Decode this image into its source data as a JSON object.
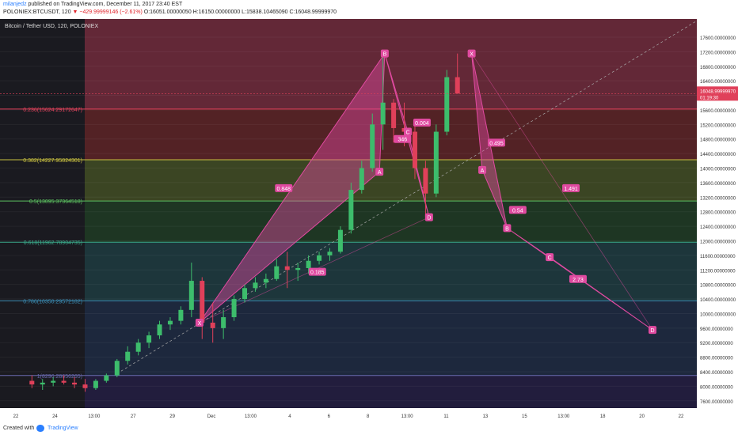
{
  "header": {
    "author": "milanjedz",
    "published": " published on TradingView.com, December 11, 2017 23:40 EST",
    "symbol": "POLONIEX:BTCUSDT, 120",
    "change": "▼ −429.99999146 (−2.61%)",
    "o": " O:16051.00000050",
    "h": " H:16150.00000000",
    "l": " L:15838.10465090",
    "c": " C:16048.99999970"
  },
  "footer": {
    "created_with": "Created with",
    "brand": "TradingView"
  },
  "colors": {
    "background": "#1a1a20",
    "fib_pink": "#6b2a3a",
    "fib_red": "#5a2426",
    "fib_olive": "#3f4a24",
    "fib_green": "#1f3a24",
    "fib_teal": "#1e3a3e",
    "fib_blue": "#1e2a40",
    "fib_purple": "#231e40",
    "up_candle": "#3dbd6c",
    "down_candle": "#e0405a",
    "pattern_fill": "#e04aa0",
    "price_tag": "#e0405a"
  },
  "chart_data": {
    "type": "candlestick",
    "title": "Bitcoin / Tether USD, 120, POLONIEX",
    "ylim": [
      7400,
      18100
    ],
    "x_ticks": [
      "22",
      "24",
      "13:00",
      "27",
      "29",
      "Dec",
      "13:00",
      "4",
      "6",
      "8",
      "13:00",
      "11",
      "13",
      "15",
      "13:00",
      "18",
      "20",
      "22"
    ],
    "y_ticks": [
      "17600.00000000",
      "17200.00000000",
      "16800.00000000",
      "16400.00000000",
      "16000.00000000",
      "15600.00000000",
      "15200.00000000",
      "14800.00000000",
      "14400.00000000",
      "14000.00000000",
      "13600.00000000",
      "13200.00000000",
      "12800.00000000",
      "12400.00000000",
      "12000.00000000",
      "11600.00000000",
      "11200.00000000",
      "10800.00000000",
      "10400.00000000",
      "10000.00000000",
      "9600.00000000",
      "9200.00000000",
      "8800.00000000",
      "8400.00000000",
      "8000.00000000",
      "7600.00000000"
    ],
    "fib_levels": [
      {
        "label": "0.236(15624.29172647)",
        "value": 15624.29,
        "color": "#e0405a"
      },
      {
        "label": "0.382(14227.95824301)",
        "value": 14227.96,
        "color": "#c8c040"
      },
      {
        "label": "0.5(13095.37364518)",
        "value": 13095.37,
        "color": "#5cc060"
      },
      {
        "label": "0.618(11962.78904735)",
        "value": 11962.79,
        "color": "#3aaa8a"
      },
      {
        "label": "0.786(10350.29572182)",
        "value": 10350.3,
        "color": "#3a8ab0"
      },
      {
        "label": "1(8296.28656265)",
        "value": 8296.29,
        "color": "#6a6ab0"
      }
    ],
    "current_price": {
      "value": 16048.9999997,
      "label": "16048.99999970",
      "countdown": "01:19:30"
    },
    "pattern_points": [
      {
        "label": "X",
        "x": "Nov 29 09:00",
        "y": 9750
      },
      {
        "label": "A",
        "x": "Dec 7 20:00",
        "y": 13900
      },
      {
        "label": "B",
        "x": "Dec 8 02:00",
        "y": 17150
      },
      {
        "label": "C",
        "x": "Dec 9 04:00",
        "y": 15000
      },
      {
        "label": "D",
        "x": "Dec 10 04:00",
        "y": 12650
      },
      {
        "label": "X",
        "x": "Dec 12 04:00",
        "y": 17150
      },
      {
        "label": "A",
        "x": "Dec 12 16:00",
        "y": 13950
      },
      {
        "label": "B",
        "x": "Dec 13 20:00",
        "y": 12350
      },
      {
        "label": "C",
        "x": "Dec 15 20:00",
        "y": 11550
      },
      {
        "label": "D",
        "x": "Dec 20 16:00",
        "y": 9550
      }
    ],
    "ratios": [
      {
        "label": "0.848",
        "x": "Dec 3 08:00",
        "y": 13450
      },
      {
        "label": "0.004",
        "x": "Dec 9 20:00",
        "y": 15250
      },
      {
        "label": "346",
        "x": "Dec 8 22:00",
        "y": 14800
      },
      {
        "label": "0.185",
        "x": "Dec 4 22:00",
        "y": 11150
      },
      {
        "label": "0.495",
        "x": "Dec 13 08:00",
        "y": 14700
      },
      {
        "label": "0.54",
        "x": "Dec 14 08:00",
        "y": 12850
      },
      {
        "label": "1.491",
        "x": "Dec 16 20:00",
        "y": 13450
      },
      {
        "label": "2.73",
        "x": "Dec 17 04:00",
        "y": 10950
      }
    ],
    "candles": [
      {
        "t": "Nov 21 12:00",
        "o": 8150,
        "h": 8300,
        "l": 7950,
        "c": 8050
      },
      {
        "t": "Nov 22 00:00",
        "o": 8050,
        "h": 8200,
        "l": 7900,
        "c": 8100
      },
      {
        "t": "Nov 22 12:00",
        "o": 8100,
        "h": 8250,
        "l": 8000,
        "c": 8150
      },
      {
        "t": "Nov 23 00:00",
        "o": 8150,
        "h": 8300,
        "l": 8050,
        "c": 8100
      },
      {
        "t": "Nov 23 12:00",
        "o": 8100,
        "h": 8250,
        "l": 7950,
        "c": 8050
      },
      {
        "t": "Nov 24 00:00",
        "o": 8050,
        "h": 8200,
        "l": 7850,
        "c": 7950
      },
      {
        "t": "Nov 24 12:00",
        "o": 7950,
        "h": 8200,
        "l": 7900,
        "c": 8150
      },
      {
        "t": "Nov 25 00:00",
        "o": 8150,
        "h": 8350,
        "l": 8100,
        "c": 8300
      },
      {
        "t": "Nov 25 12:00",
        "o": 8300,
        "h": 8750,
        "l": 8250,
        "c": 8700
      },
      {
        "t": "Nov 26 00:00",
        "o": 8700,
        "h": 9100,
        "l": 8600,
        "c": 8950
      },
      {
        "t": "Nov 26 12:00",
        "o": 8950,
        "h": 9300,
        "l": 8850,
        "c": 9200
      },
      {
        "t": "Nov 27 00:00",
        "o": 9200,
        "h": 9500,
        "l": 9050,
        "c": 9400
      },
      {
        "t": "Nov 27 12:00",
        "o": 9400,
        "h": 9800,
        "l": 9300,
        "c": 9700
      },
      {
        "t": "Nov 28 00:00",
        "o": 9700,
        "h": 9900,
        "l": 9550,
        "c": 9800
      },
      {
        "t": "Nov 28 12:00",
        "o": 9800,
        "h": 10200,
        "l": 9700,
        "c": 10100
      },
      {
        "t": "Nov 29 00:00",
        "o": 10100,
        "h": 11400,
        "l": 9900,
        "c": 10900
      },
      {
        "t": "Nov 29 12:00",
        "o": 10900,
        "h": 11000,
        "l": 9300,
        "c": 9750
      },
      {
        "t": "Nov 30 00:00",
        "o": 9750,
        "h": 10300,
        "l": 9200,
        "c": 9600
      },
      {
        "t": "Nov 30 12:00",
        "o": 9600,
        "h": 10100,
        "l": 9300,
        "c": 9900
      },
      {
        "t": "Dec 1 00:00",
        "o": 9900,
        "h": 10500,
        "l": 9800,
        "c": 10400
      },
      {
        "t": "Dec 1 12:00",
        "o": 10400,
        "h": 10800,
        "l": 10300,
        "c": 10700
      },
      {
        "t": "Dec 2 00:00",
        "o": 10700,
        "h": 11000,
        "l": 10600,
        "c": 10850
      },
      {
        "t": "Dec 2 12:00",
        "o": 10850,
        "h": 11100,
        "l": 10700,
        "c": 10950
      },
      {
        "t": "Dec 3 00:00",
        "o": 10950,
        "h": 11500,
        "l": 10900,
        "c": 11300
      },
      {
        "t": "Dec 3 12:00",
        "o": 11300,
        "h": 11700,
        "l": 10700,
        "c": 11200
      },
      {
        "t": "Dec 4 00:00",
        "o": 11200,
        "h": 11400,
        "l": 10900,
        "c": 11250
      },
      {
        "t": "Dec 4 12:00",
        "o": 11250,
        "h": 11600,
        "l": 11100,
        "c": 11450
      },
      {
        "t": "Dec 5 00:00",
        "o": 11450,
        "h": 11700,
        "l": 11350,
        "c": 11600
      },
      {
        "t": "Dec 5 12:00",
        "o": 11600,
        "h": 11800,
        "l": 11450,
        "c": 11700
      },
      {
        "t": "Dec 6 00:00",
        "o": 11700,
        "h": 12400,
        "l": 11650,
        "c": 12300
      },
      {
        "t": "Dec 6 12:00",
        "o": 12300,
        "h": 13600,
        "l": 12200,
        "c": 13400
      },
      {
        "t": "Dec 7 00:00",
        "o": 13400,
        "h": 14200,
        "l": 13300,
        "c": 14000
      },
      {
        "t": "Dec 7 12:00",
        "o": 14000,
        "h": 15500,
        "l": 13900,
        "c": 15200
      },
      {
        "t": "Dec 8 00:00",
        "o": 15200,
        "h": 17150,
        "l": 14500,
        "c": 15800
      },
      {
        "t": "Dec 8 12:00",
        "o": 15800,
        "h": 15900,
        "l": 14700,
        "c": 15100
      },
      {
        "t": "Dec 9 00:00",
        "o": 15100,
        "h": 15800,
        "l": 14600,
        "c": 15000
      },
      {
        "t": "Dec 9 12:00",
        "o": 15000,
        "h": 15300,
        "l": 13700,
        "c": 14000
      },
      {
        "t": "Dec 10 00:00",
        "o": 14000,
        "h": 14200,
        "l": 12650,
        "c": 13300
      },
      {
        "t": "Dec 10 12:00",
        "o": 13300,
        "h": 15200,
        "l": 13200,
        "c": 15000
      },
      {
        "t": "Dec 11 00:00",
        "o": 15000,
        "h": 16700,
        "l": 14900,
        "c": 16500
      },
      {
        "t": "Dec 11 12:00",
        "o": 16500,
        "h": 17150,
        "l": 16200,
        "c": 16049
      }
    ]
  }
}
